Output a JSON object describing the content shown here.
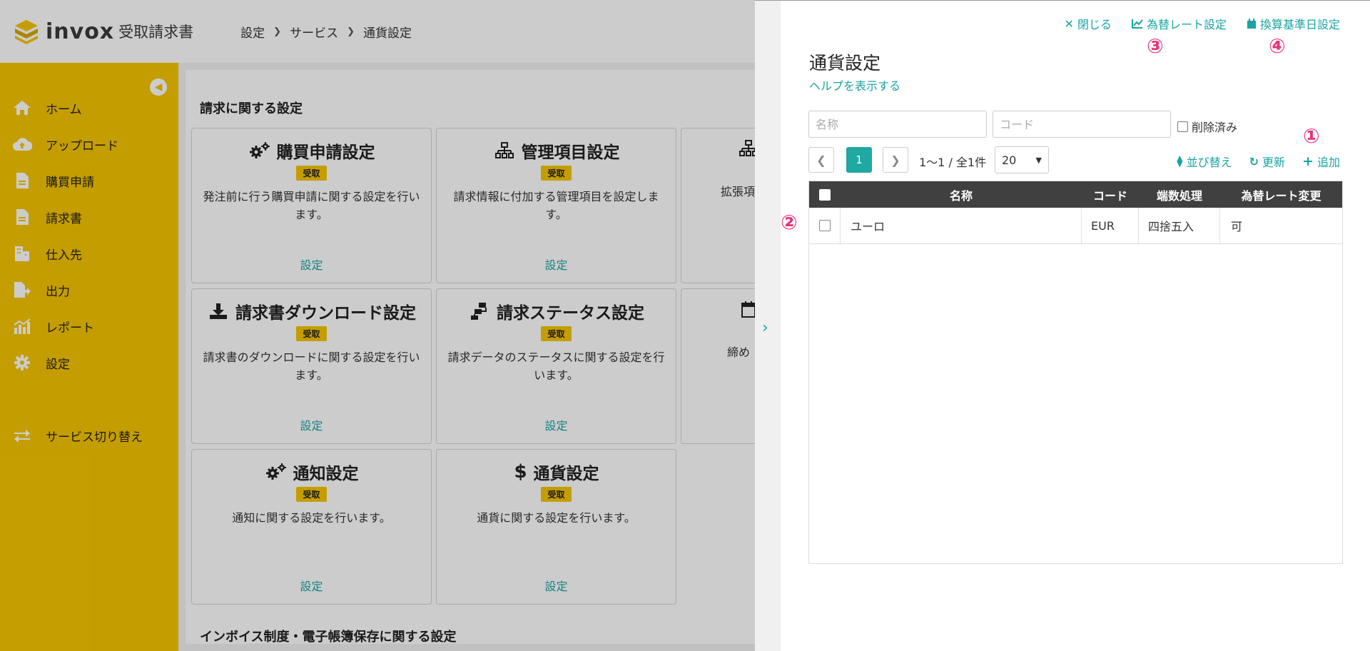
{
  "app": {
    "logo_word": "invox",
    "product": "受取請求書",
    "breadcrumb": [
      "設定",
      "サービス",
      "通貨設定"
    ]
  },
  "sidebar": {
    "items": [
      {
        "label": "ホーム",
        "icon": "home-icon"
      },
      {
        "label": "アップロード",
        "icon": "cloud-upload-icon"
      },
      {
        "label": "購買申請",
        "icon": "document-icon"
      },
      {
        "label": "請求書",
        "icon": "document-icon"
      },
      {
        "label": "仕入先",
        "icon": "building-icon"
      },
      {
        "label": "出力",
        "icon": "file-export-icon"
      },
      {
        "label": "レポート",
        "icon": "bar-chart-icon"
      },
      {
        "label": "設定",
        "icon": "gear-icon"
      }
    ],
    "switch_label": "サービス切り替え"
  },
  "content": {
    "section1_title": "請求に関する設定",
    "section2_title": "インボイス制度・電子帳簿保存に関する設定",
    "badge": "受取",
    "link": "設定",
    "cards": [
      {
        "title": "購買申請設定",
        "desc": "発注前に行う購買申請に関する設定を行います。"
      },
      {
        "title": "管理項目設定",
        "desc": "請求情報に付加する管理項目を設定します。"
      },
      {
        "title": "",
        "desc": "拡張項"
      },
      {
        "title": "請求書ダウンロード設定",
        "desc": "請求書のダウンロードに関する設定を行います。"
      },
      {
        "title": "請求ステータス設定",
        "desc": "請求データのステータスに関する設定を行います。"
      },
      {
        "title": "",
        "desc": "締め"
      },
      {
        "title": "通知設定",
        "desc": "通知に関する設定を行います。"
      },
      {
        "title": "通貨設定",
        "desc": "通貨に関する設定を行います。"
      }
    ]
  },
  "panel": {
    "close": "閉じる",
    "fx_rate_setting": "為替レート設定",
    "base_date_setting": "換算基準日設定",
    "title": "通貨設定",
    "help": "ヘルプを表示する",
    "name_placeholder": "名称",
    "code_placeholder": "コード",
    "deleted_label": "削除済み",
    "page_current": "1",
    "page_info": "1〜1 / 全1件",
    "page_size": "20",
    "sort": "並び替え",
    "refresh": "更新",
    "add": "追加",
    "columns": [
      "名称",
      "コード",
      "端数処理",
      "為替レート変更"
    ],
    "rows": [
      {
        "name": "ユーロ",
        "code": "EUR",
        "rounding": "四捨五入",
        "fx_change": "可"
      }
    ]
  },
  "markers": [
    "①",
    "②",
    "③",
    "④"
  ],
  "colors": {
    "brand_yellow": "#f6c500",
    "accent_teal": "#1aa3a3",
    "marker_pink": "#e8327c",
    "grid_header": "#404040"
  }
}
